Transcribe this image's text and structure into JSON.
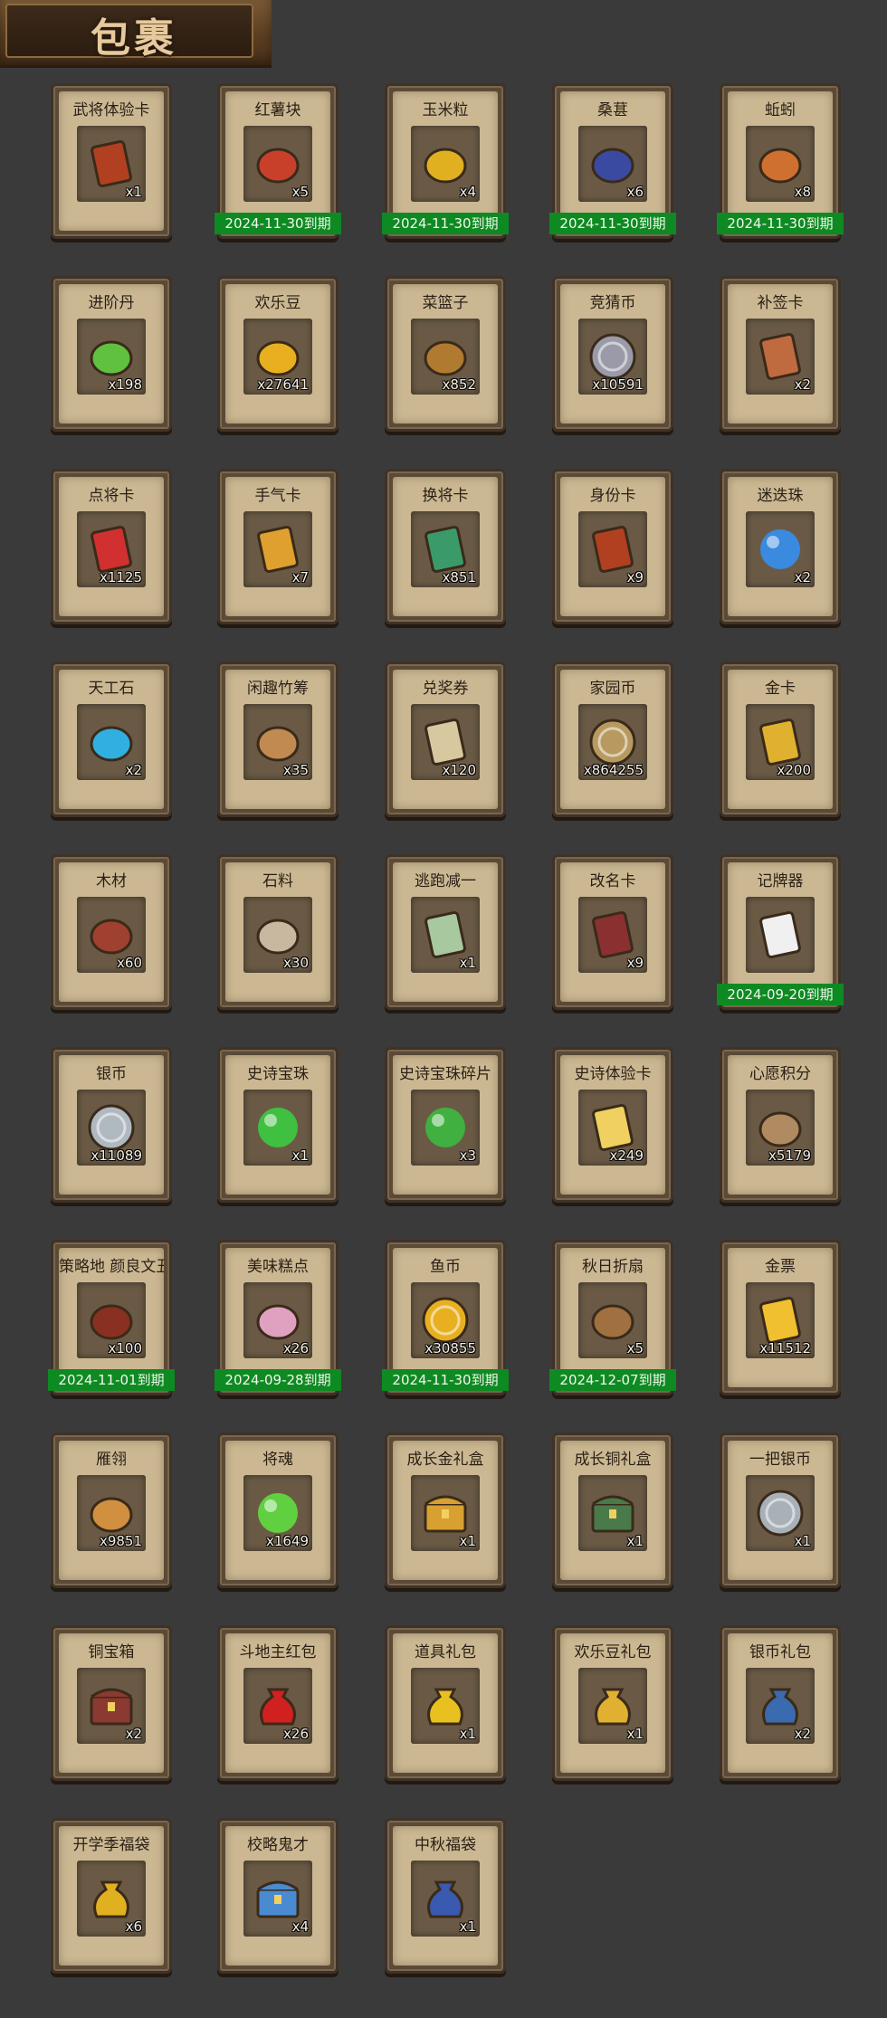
{
  "header": {
    "title": "包裹"
  },
  "items": [
    {
      "name": "武将体验卡",
      "count": "x1",
      "expiry": "",
      "icon": "general-trial-card-icon",
      "color": "#b04020"
    },
    {
      "name": "红薯块",
      "count": "x5",
      "expiry": "2024-11-30到期",
      "icon": "sweet-potato-icon",
      "color": "#c8402a"
    },
    {
      "name": "玉米粒",
      "count": "x4",
      "expiry": "2024-11-30到期",
      "icon": "corn-icon",
      "color": "#e0b020"
    },
    {
      "name": "桑葚",
      "count": "x6",
      "expiry": "2024-11-30到期",
      "icon": "mulberry-icon",
      "color": "#3a4aa0"
    },
    {
      "name": "蚯蚓",
      "count": "x8",
      "expiry": "2024-11-30到期",
      "icon": "earthworm-icon",
      "color": "#d07030"
    },
    {
      "name": "进阶丹",
      "count": "x198",
      "expiry": "",
      "icon": "advance-pill-icon",
      "color": "#60c040"
    },
    {
      "name": "欢乐豆",
      "count": "x27641",
      "expiry": "",
      "icon": "happy-bean-icon",
      "color": "#e8b020"
    },
    {
      "name": "菜篮子",
      "count": "x852",
      "expiry": "",
      "icon": "vegetable-basket-icon",
      "color": "#b07a30"
    },
    {
      "name": "竞猜币",
      "count": "x10591",
      "expiry": "",
      "icon": "quiz-coin-icon",
      "color": "#9a9aa8"
    },
    {
      "name": "补签卡",
      "count": "x2",
      "expiry": "",
      "icon": "resign-card-icon",
      "color": "#c06a40"
    },
    {
      "name": "点将卡",
      "count": "x1125",
      "expiry": "",
      "icon": "summon-general-card-icon",
      "color": "#d03030"
    },
    {
      "name": "手气卡",
      "count": "x7",
      "expiry": "",
      "icon": "luck-card-icon",
      "color": "#e0a030"
    },
    {
      "name": "换将卡",
      "count": "x851",
      "expiry": "",
      "icon": "swap-general-card-icon",
      "color": "#3a9a6a"
    },
    {
      "name": "身份卡",
      "count": "x9",
      "expiry": "",
      "icon": "identity-card-icon",
      "color": "#b04020"
    },
    {
      "name": "迷迭珠",
      "count": "x2",
      "expiry": "",
      "icon": "blue-orb-icon",
      "color": "#3a8ae0"
    },
    {
      "name": "天工石",
      "count": "x2",
      "expiry": "",
      "icon": "crystal-stone-icon",
      "color": "#30b0e0"
    },
    {
      "name": "闲趣竹筹",
      "count": "x35",
      "expiry": "",
      "icon": "bamboo-token-icon",
      "color": "#c08a50"
    },
    {
      "name": "兑奖券",
      "count": "x120",
      "expiry": "",
      "icon": "prize-ticket-icon",
      "color": "#d8c8a0"
    },
    {
      "name": "家园币",
      "count": "x864255",
      "expiry": "",
      "icon": "homeland-coin-icon",
      "color": "#b89a60"
    },
    {
      "name": "金卡",
      "count": "x200",
      "expiry": "",
      "icon": "gold-card-icon",
      "color": "#e0b030"
    },
    {
      "name": "木材",
      "count": "x60",
      "expiry": "",
      "icon": "wood-icon",
      "color": "#a04030"
    },
    {
      "name": "石料",
      "count": "x30",
      "expiry": "",
      "icon": "stone-icon",
      "color": "#c8b8a0"
    },
    {
      "name": "逃跑减一",
      "count": "x1",
      "expiry": "",
      "icon": "escape-tag-icon",
      "color": "#a8c8a0"
    },
    {
      "name": "改名卡",
      "count": "x9",
      "expiry": "",
      "icon": "rename-card-icon",
      "color": "#8a3030"
    },
    {
      "name": "记牌器",
      "count": "",
      "expiry": "2024-09-20到期",
      "icon": "card-counter-icon",
      "color": "#f0f0f0"
    },
    {
      "name": "银币",
      "count": "x11089",
      "expiry": "",
      "icon": "silver-coin-icon",
      "color": "#b0b8c0"
    },
    {
      "name": "史诗宝珠",
      "count": "x1",
      "expiry": "",
      "icon": "epic-orb-icon",
      "color": "#40c040"
    },
    {
      "name": "史诗宝珠碎片",
      "count": "x3",
      "expiry": "",
      "icon": "epic-orb-shard-icon",
      "color": "#40b040"
    },
    {
      "name": "史诗体验卡",
      "count": "x249",
      "expiry": "",
      "icon": "epic-trial-card-icon",
      "color": "#f0d060"
    },
    {
      "name": "心愿积分",
      "count": "x5179",
      "expiry": "",
      "icon": "wish-points-icon",
      "color": "#b08a60"
    },
    {
      "name": "策略地 颜良文丑",
      "count": "x100",
      "expiry": "2024-11-01到期",
      "icon": "general-portrait-icon",
      "color": "#8a3020"
    },
    {
      "name": "美味糕点",
      "count": "x26",
      "expiry": "2024-09-28到期",
      "icon": "pastry-icon",
      "color": "#e0a0c0"
    },
    {
      "name": "鱼币",
      "count": "x30855",
      "expiry": "2024-11-30到期",
      "icon": "fish-coin-icon",
      "color": "#e8b020"
    },
    {
      "name": "秋日折扇",
      "count": "x5",
      "expiry": "2024-12-07到期",
      "icon": "folding-fan-icon",
      "color": "#a07040"
    },
    {
      "name": "金票",
      "count": "x11512",
      "expiry": "",
      "icon": "gold-ticket-icon",
      "color": "#f0c030"
    },
    {
      "name": "雁翎",
      "count": "x9851",
      "expiry": "",
      "icon": "feather-icon",
      "color": "#d09040"
    },
    {
      "name": "将魂",
      "count": "x1649",
      "expiry": "",
      "icon": "general-soul-icon",
      "color": "#60d040"
    },
    {
      "name": "成长金礼盒",
      "count": "x1",
      "expiry": "",
      "icon": "gold-chest-icon",
      "color": "#d8a030"
    },
    {
      "name": "成长铜礼盒",
      "count": "x1",
      "expiry": "",
      "icon": "bronze-chest-icon",
      "color": "#4a7a4a"
    },
    {
      "name": "一把银币",
      "count": "x1",
      "expiry": "",
      "icon": "silver-coins-icon",
      "color": "#a8b0b8"
    },
    {
      "name": "铜宝箱",
      "count": "x2",
      "expiry": "",
      "icon": "copper-chest-icon",
      "color": "#8a3a30"
    },
    {
      "name": "斗地主红包",
      "count": "x26",
      "expiry": "",
      "icon": "red-envelope-icon",
      "color": "#d02020"
    },
    {
      "name": "道具礼包",
      "count": "x1",
      "expiry": "",
      "icon": "item-gift-bag-icon",
      "color": "#e8c020"
    },
    {
      "name": "欢乐豆礼包",
      "count": "x1",
      "expiry": "",
      "icon": "bean-gift-bag-icon",
      "color": "#e0b030"
    },
    {
      "name": "银币礼包",
      "count": "x2",
      "expiry": "",
      "icon": "silver-gift-bag-icon",
      "color": "#3a6ab0"
    },
    {
      "name": "开学季福袋",
      "count": "x6",
      "expiry": "",
      "icon": "school-lucky-bag-icon",
      "color": "#e0b020"
    },
    {
      "name": "校略鬼才",
      "count": "x4",
      "expiry": "",
      "icon": "gift-box-icon",
      "color": "#4a8ad0"
    },
    {
      "name": "中秋福袋",
      "count": "x1",
      "expiry": "",
      "icon": "mid-autumn-bag-icon",
      "color": "#3a5ab0"
    }
  ]
}
